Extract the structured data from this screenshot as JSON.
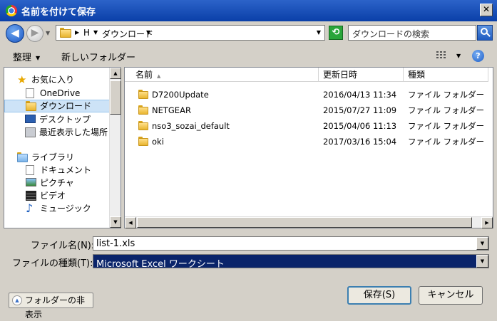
{
  "window": {
    "title": "名前を付けて保存",
    "close_glyph": "✕"
  },
  "navbar": {
    "back_glyph": "◀",
    "forward_glyph": "▶",
    "breadcrumb": [
      "H",
      "ダウンロード"
    ],
    "refresh_glyph": "⟲",
    "search_placeholder": "ダウンロードの検索"
  },
  "toolbar": {
    "organize": "整理",
    "new_folder": "新しいフォルダー",
    "help_glyph": "?"
  },
  "nav_pane": {
    "favorites": "お気に入り",
    "favorite_items": [
      "OneDrive",
      "ダウンロード",
      "デスクトップ",
      "最近表示した場所"
    ],
    "libraries": "ライブラリ",
    "library_items": [
      "ドキュメント",
      "ピクチャ",
      "ビデオ",
      "ミュージック"
    ]
  },
  "file_list": {
    "columns": [
      "名前",
      "更新日時",
      "種類"
    ],
    "rows": [
      {
        "name": "D7200Update",
        "modified": "2016/04/13 11:34",
        "type": "ファイル フォルダー"
      },
      {
        "name": "NETGEAR",
        "modified": "2015/07/27 11:09",
        "type": "ファイル フォルダー"
      },
      {
        "name": "nso3_sozai_default",
        "modified": "2015/04/06 11:13",
        "type": "ファイル フォルダー"
      },
      {
        "name": "oki",
        "modified": "2017/03/16 15:04",
        "type": "ファイル フォルダー"
      }
    ]
  },
  "save_form": {
    "filename_label": "ファイル名(N):",
    "filename_value": "list-1.xls",
    "filetype_label": "ファイルの種類(T):",
    "filetype_value": "Microsoft Excel ワークシート"
  },
  "footer": {
    "hide_folders": "フォルダーの非表示",
    "save": "保存(S)",
    "cancel": "キャンセル"
  }
}
